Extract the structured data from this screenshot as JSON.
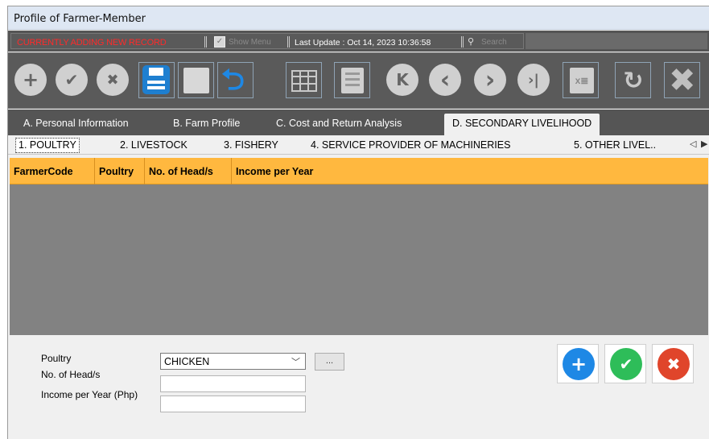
{
  "window": {
    "title": "Profile of Farmer-Member"
  },
  "status": {
    "mode": "CURRENTLY ADDING NEW RECORD",
    "show_menu": "Show Menu",
    "last_update": "Last Update : Oct 14, 2023 10:36:58",
    "search": "Search"
  },
  "toolbar": {
    "add": "+",
    "confirm": "✔",
    "cancel": "✖",
    "undo": "⮌",
    "export": "x≣",
    "refresh": "↻",
    "close": "✖",
    "first": "K",
    "prev": "‹",
    "next": "›",
    "last": "›|"
  },
  "tabs": [
    {
      "label": "A. Personal Information"
    },
    {
      "label": "B. Farm Profile"
    },
    {
      "label": "C. Cost and Return Analysis"
    },
    {
      "label": "D. SECONDARY LIVELIHOOD"
    }
  ],
  "subtabs": [
    {
      "label": "1. POULTRY"
    },
    {
      "label": "2. LIVESTOCK"
    },
    {
      "label": "3. FISHERY"
    },
    {
      "label": "4. SERVICE PROVIDER OF MACHINERIES"
    },
    {
      "label": "5. OTHER LIVEL.."
    }
  ],
  "grid": {
    "columns": [
      "FarmerCode",
      "Poultry",
      "No. of Head/s",
      "Income per Year"
    ],
    "rows": []
  },
  "form": {
    "poultry_label": "Poultry",
    "poultry_value": "CHICKEN",
    "heads_label": "No. of Head/s",
    "heads_value": "",
    "income_label": "Income per Year (Php)",
    "income_value": "",
    "browse_label": "..."
  },
  "actions": {
    "add": "+",
    "save": "✔",
    "cancel": "✖"
  },
  "colors": {
    "grid_header": "#ffb83f",
    "mode_text": "#ff2a2a",
    "save_blue": "#1e7fd0",
    "add_blue": "#1e88e5",
    "confirm_green": "#2ebd59",
    "cancel_red": "#e0452b"
  }
}
